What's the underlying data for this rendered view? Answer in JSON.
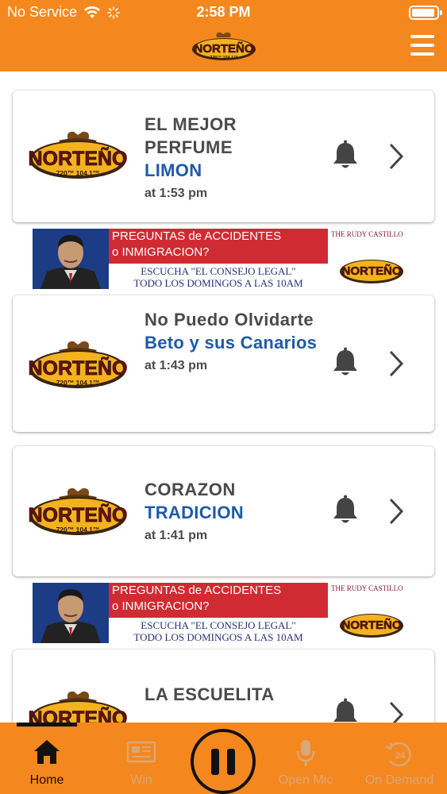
{
  "status_bar": {
    "carrier": "No Service",
    "time": "2:58 PM"
  },
  "header": {
    "logo_text": "NORTEÑO",
    "logo_subtext": "720™ 104.1™",
    "menu_icon": "hamburger-icon"
  },
  "tracks": [
    {
      "song": "EL MEJOR PERFUME",
      "artist": "LIMON",
      "time": "at 1:53 pm"
    },
    {
      "song": "No Puedo Olvidarte",
      "artist": "Beto y sus Canarios",
      "time": "at 1:43 pm"
    },
    {
      "song": "CORAZON",
      "artist": "TRADICION",
      "time": "at 1:41 pm"
    },
    {
      "song": "LA ESCUELITA",
      "artist": "",
      "time": ""
    }
  ],
  "ad": {
    "headline_1": "PREGUNTAS de ACCIDENTES",
    "headline_2": "o INMIGRACION?",
    "line_1": "ESCUCHA \"EL CONSEJO LEGAL\"",
    "line_2": "TODO LOS DOMINGOS A LAS 10AM",
    "firm": "THE RUDY CASTILLO"
  },
  "tabbar": {
    "tabs": [
      {
        "label": "Home",
        "icon": "home-icon",
        "active": true
      },
      {
        "label": "Win",
        "icon": "ticket-icon",
        "active": false
      },
      {
        "label": "Open Mic",
        "icon": "microphone-icon",
        "active": false
      },
      {
        "label": "On Demand",
        "icon": "on-demand-24-icon",
        "active": false
      }
    ],
    "play_icon": "pause-icon",
    "on_demand_badge": "24"
  },
  "colors": {
    "brand_orange": "#f5871f",
    "artist_blue": "#1f5aa8",
    "song_grey": "#4a4a4a",
    "ad_red": "#d02a32"
  }
}
